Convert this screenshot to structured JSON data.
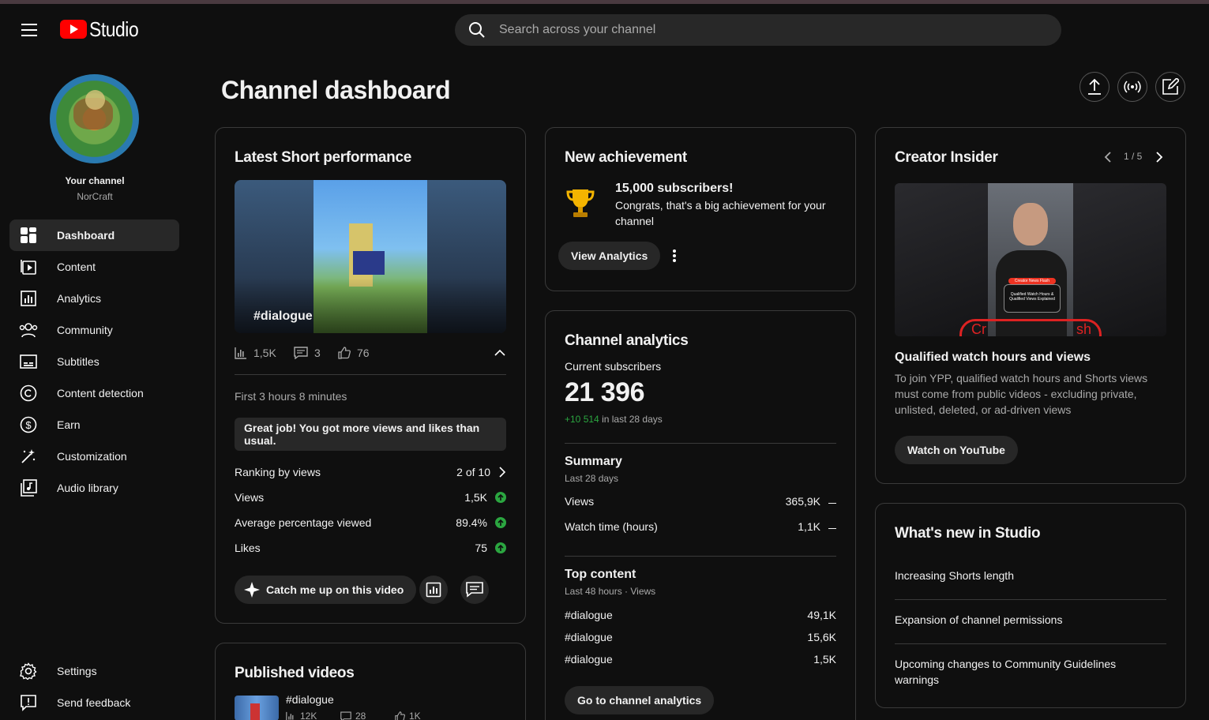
{
  "header": {
    "brand": "Studio",
    "search_placeholder": "Search across your channel"
  },
  "sidebar": {
    "your_channel_label": "Your channel",
    "channel_name": "NorCraft",
    "items": [
      {
        "label": "Dashboard",
        "icon": "dashboard-icon"
      },
      {
        "label": "Content",
        "icon": "content-icon"
      },
      {
        "label": "Analytics",
        "icon": "analytics-icon"
      },
      {
        "label": "Community",
        "icon": "community-icon"
      },
      {
        "label": "Subtitles",
        "icon": "subtitles-icon"
      },
      {
        "label": "Content detection",
        "icon": "copyright-icon"
      },
      {
        "label": "Earn",
        "icon": "dollar-icon"
      },
      {
        "label": "Customization",
        "icon": "magic-wand-icon"
      },
      {
        "label": "Audio library",
        "icon": "audio-library-icon"
      }
    ],
    "footer": [
      {
        "label": "Settings",
        "icon": "gear-icon"
      },
      {
        "label": "Send feedback",
        "icon": "feedback-icon"
      }
    ]
  },
  "main": {
    "title": "Channel dashboard"
  },
  "latest_short": {
    "title": "Latest Short performance",
    "thumb_tag": "#dialogue",
    "views": "1,5K",
    "comments": "3",
    "likes": "76",
    "period": "First 3 hours 8 minutes",
    "banner": "Great job! You got more views and likes than usual.",
    "metrics": [
      {
        "name": "Ranking by views",
        "value": "2 of 10"
      },
      {
        "name": "Views",
        "value": "1,5K"
      },
      {
        "name": "Average percentage viewed",
        "value": "89.4%"
      },
      {
        "name": "Likes",
        "value": "75"
      }
    ],
    "catch_up_label": "Catch me up on this video"
  },
  "published": {
    "title": "Published videos",
    "video_title": "#dialogue",
    "views": "12K",
    "comments": "28",
    "likes": "1K"
  },
  "achievement": {
    "title": "New achievement",
    "headline": "15,000 subscribers!",
    "message": "Congrats, that's a big achievement for your channel",
    "button": "View Analytics"
  },
  "analytics": {
    "title": "Channel analytics",
    "current_subs_label": "Current subscribers",
    "subscribers": "21 396",
    "delta": "+10 514",
    "delta_suffix": "in last 28 days",
    "summary_title": "Summary",
    "summary_period": "Last 28 days",
    "summary_rows": [
      {
        "name": "Views",
        "value": "365,9K"
      },
      {
        "name": "Watch time (hours)",
        "value": "1,1K"
      }
    ],
    "top_title": "Top content",
    "top_period": "Last 48 hours · Views",
    "top_rows": [
      {
        "name": "#dialogue",
        "value": "49,1K"
      },
      {
        "name": "#dialogue",
        "value": "15,6K"
      },
      {
        "name": "#dialogue",
        "value": "1,5K"
      }
    ],
    "button": "Go to channel analytics"
  },
  "creator_insider": {
    "title": "Creator Insider",
    "pager": "1 / 5",
    "thumb_badge": "Creator News Flash",
    "thumb_caption": "Qualified Watch Hours & Qualified Views Explained",
    "thumb_arc": "Cr",
    "thumb_arc_right": "sh",
    "video_title": "Qualified watch hours and views",
    "description": "To join YPP, qualified watch hours and Shorts views must come from public videos - excluding private, unlisted, deleted, or ad-driven views",
    "button": "Watch on YouTube"
  },
  "whats_new": {
    "title": "What's new in Studio",
    "items": [
      "Increasing Shorts length",
      "Expansion of channel permissions",
      "Upcoming changes to Community Guidelines warnings"
    ]
  },
  "colors": {
    "accent_red": "#ff0000",
    "positive_green": "#2ba640",
    "background": "#0f0f0f"
  }
}
